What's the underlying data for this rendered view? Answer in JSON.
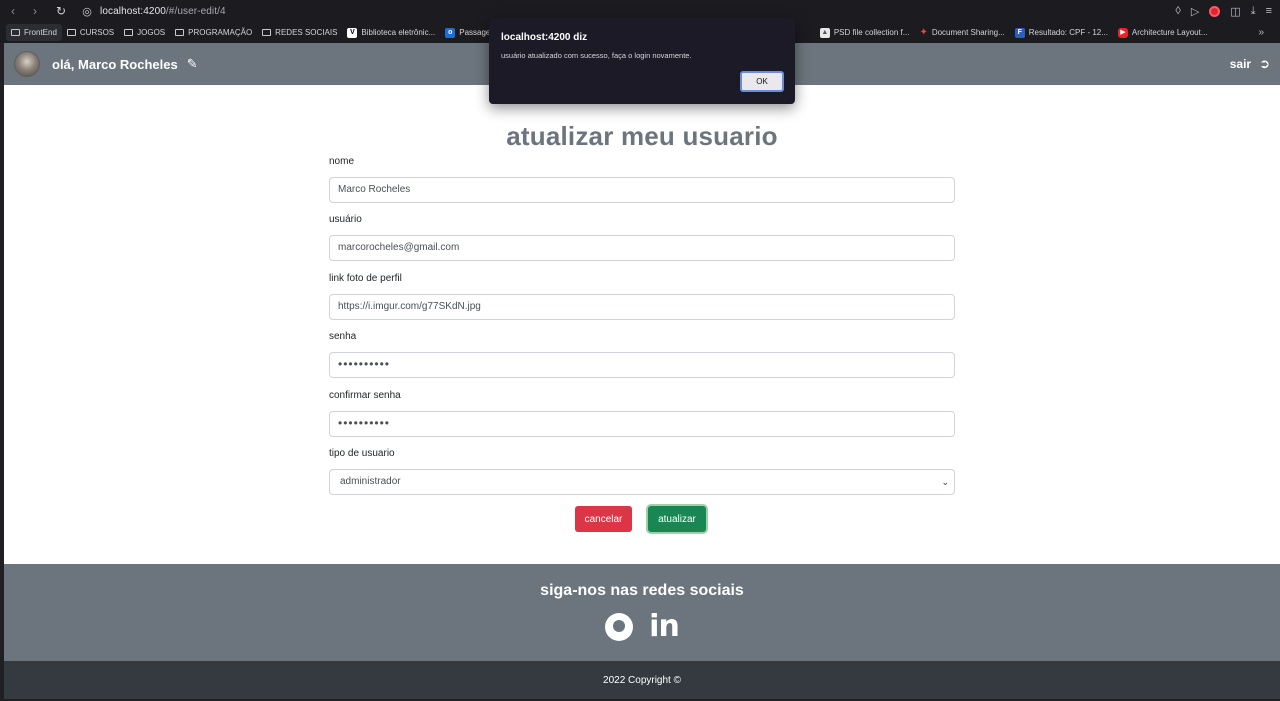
{
  "browser": {
    "url_host": "localhost:4200",
    "url_path": "/#/user-edit/4",
    "bookmarks": [
      {
        "label": "FrontEnd",
        "type": "folder"
      },
      {
        "label": "CURSOS",
        "type": "folder"
      },
      {
        "label": "JOGOS",
        "type": "folder"
      },
      {
        "label": "PROGRAMAÇÃO",
        "type": "folder"
      },
      {
        "label": "REDES SOCIAIS",
        "type": "folder"
      },
      {
        "label": "Biblioteca eletrônic...",
        "type": "site"
      },
      {
        "label": "Passagens",
        "type": "site"
      },
      {
        "label": "PSD file collection f...",
        "type": "site"
      },
      {
        "label": "Document Sharing...",
        "type": "site"
      },
      {
        "label": "Resultado: CPF - 12...",
        "type": "site"
      },
      {
        "label": "Architecture Layout...",
        "type": "site"
      }
    ],
    "more_label": "»"
  },
  "navbar": {
    "greeting": "olá, Marco Rocheles",
    "logout_label": "sair"
  },
  "form": {
    "title": "atualizar meu usuario",
    "name_label": "nome",
    "name_value": "Marco Rocheles",
    "user_label": "usuário",
    "user_value": "marcorocheles@gmail.com",
    "photo_label": "link foto de perfil",
    "photo_value": "https://i.imgur.com/g77SKdN.jpg",
    "password_label": "senha",
    "password_value": "••••••••••",
    "confirm_label": "confirmar senha",
    "confirm_value": "••••••••••",
    "type_label": "tipo de usuario",
    "type_value": "administrador",
    "cancel_label": "cancelar",
    "update_label": "atualizar"
  },
  "footer": {
    "social_title": "siga-nos nas redes sociais",
    "copyright": "2022 Copyright ©"
  },
  "dialog": {
    "title": "localhost:4200 diz",
    "message": "usuário atualizado com sucesso, faça o login novamente.",
    "ok_label": "OK"
  },
  "colors": {
    "navbar": "#6c757d",
    "cancel": "#dc3545",
    "update": "#198754",
    "copyright_bar": "#343a40"
  }
}
